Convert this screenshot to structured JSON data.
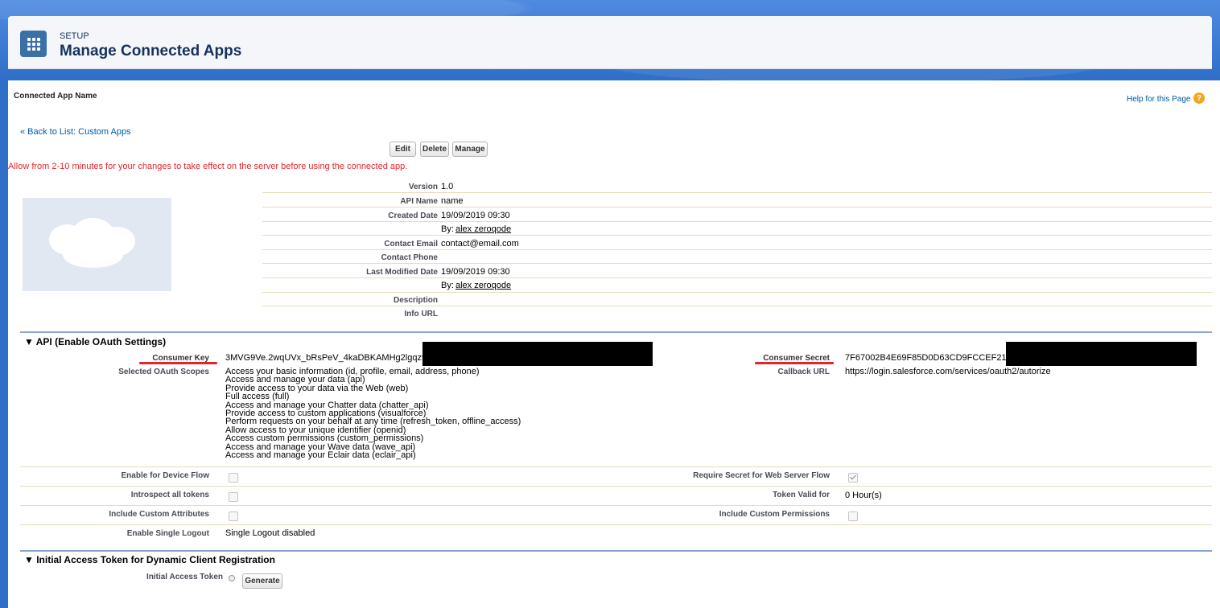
{
  "header": {
    "setup_label": "SETUP",
    "title": "Manage Connected Apps"
  },
  "page": {
    "app_name_label": "Connected App Name",
    "help_link": "Help for this Page",
    "back_link": "« Back to List: Custom Apps",
    "warning": "Allow from 2-10 minutes for your changes to take effect on the server before using the connected app."
  },
  "toolbar": {
    "edit_label": "Edit",
    "delete_label": "Delete",
    "manage_label": "Manage"
  },
  "details": [
    {
      "label": "Version",
      "value": "1.0"
    },
    {
      "label": "API Name",
      "value": "name"
    },
    {
      "label": "Created Date",
      "value": "19/09/2019 09:30"
    },
    {
      "label": "",
      "value_prefix": "By: ",
      "value": "alex zeroqode"
    },
    {
      "label": "Contact Email",
      "value": "contact@email.com"
    },
    {
      "label": "Contact Phone",
      "value": ""
    },
    {
      "label": "Last Modified Date",
      "value": "19/09/2019 09:30"
    },
    {
      "label": "",
      "value_prefix": "By: ",
      "value": "alex zeroqode"
    },
    {
      "label": "Description",
      "value": ""
    },
    {
      "label": "Info URL",
      "value": ""
    }
  ],
  "api_section": {
    "title": "▼ API (Enable OAuth Settings)",
    "consumer_key_label": "Consumer Key",
    "consumer_key_value": "3MVG9Ve.2wqUVx_bRsPeV_4kaDBKAMHg2lgqz96F",
    "consumer_secret_label": "Consumer Secret",
    "consumer_secret_value": "7F67002B4E69F85D0D63CD9FCCEF21B2",
    "scopes_label": "Selected OAuth Scopes",
    "scopes": [
      "Access your basic information (id, profile, email, address, phone)",
      "Access and manage your data (api)",
      "Provide access to your data via the Web (web)",
      "Full access (full)",
      "Access and manage your Chatter data (chatter_api)",
      "Provide access to custom applications (visualforce)",
      "Perform requests on your behalf at any time (refresh_token, offline_access)",
      "Allow access to your unique identifier (openid)",
      "Access custom permissions (custom_permissions)",
      "Access and manage your Wave data (wave_api)",
      "Access and manage your Eclair data (eclair_api)"
    ],
    "callback_label": "Callback URL",
    "callback_value": "https://login.salesforce.com/services/oauth2/autorize",
    "device_flow_label": "Enable for Device Flow",
    "device_flow_checked": false,
    "require_secret_label": "Require Secret for Web Server Flow",
    "require_secret_checked": true,
    "introspect_label": "Introspect all tokens",
    "introspect_checked": false,
    "token_valid_label": "Token Valid for",
    "token_valid_value": "0 Hour(s)",
    "custom_attr_label": "Include Custom Attributes",
    "custom_attr_checked": false,
    "custom_perm_label": "Include Custom Permissions",
    "custom_perm_checked": false,
    "single_logout_label": "Enable Single Logout",
    "single_logout_value": "Single Logout disabled"
  },
  "token_section": {
    "title": "▼ Initial Access Token for Dynamic Client Registration",
    "token_label": "Initial Access Token",
    "generate_label": "Generate"
  },
  "colors": {
    "brand_blue": "#2f6fc9",
    "link_blue": "#015ba7",
    "warning_red": "#e0262d",
    "title_navy": "#16325c"
  }
}
